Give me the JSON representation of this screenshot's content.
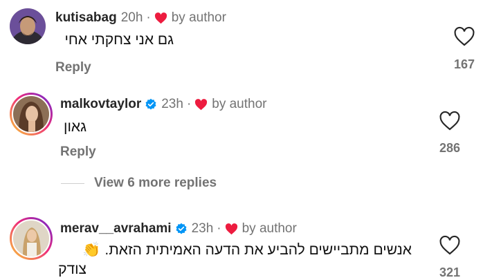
{
  "colors": {
    "heart_red": "#ed1c3f",
    "verified_blue": "#0095f6",
    "secondary_text": "#737373"
  },
  "comments": [
    {
      "username": "kutisabag",
      "time": "20h",
      "separator": "·",
      "liked_by": "by author",
      "text": "גם אני צחקתי אחי",
      "reply_label": "Reply",
      "likes": "167",
      "verified": false
    },
    {
      "username": "malkovtaylor",
      "time": "23h",
      "separator": "·",
      "liked_by": "by author",
      "text": "גאון",
      "reply_label": "Reply",
      "likes": "286",
      "verified": true
    },
    {
      "username": "merav__avrahami",
      "time": "23h",
      "separator": "·",
      "liked_by": "by author",
      "text_line1": "אנשים מתביישים להביע את הדעה האמיתית הזאת. 👏",
      "text_line2": "צודק",
      "likes": "321",
      "verified": true
    }
  ],
  "view_more": "View 6 more replies",
  "icons": [
    "heart-outline-icon",
    "heart-filled-icon",
    "verified-badge-icon",
    "avatar"
  ]
}
